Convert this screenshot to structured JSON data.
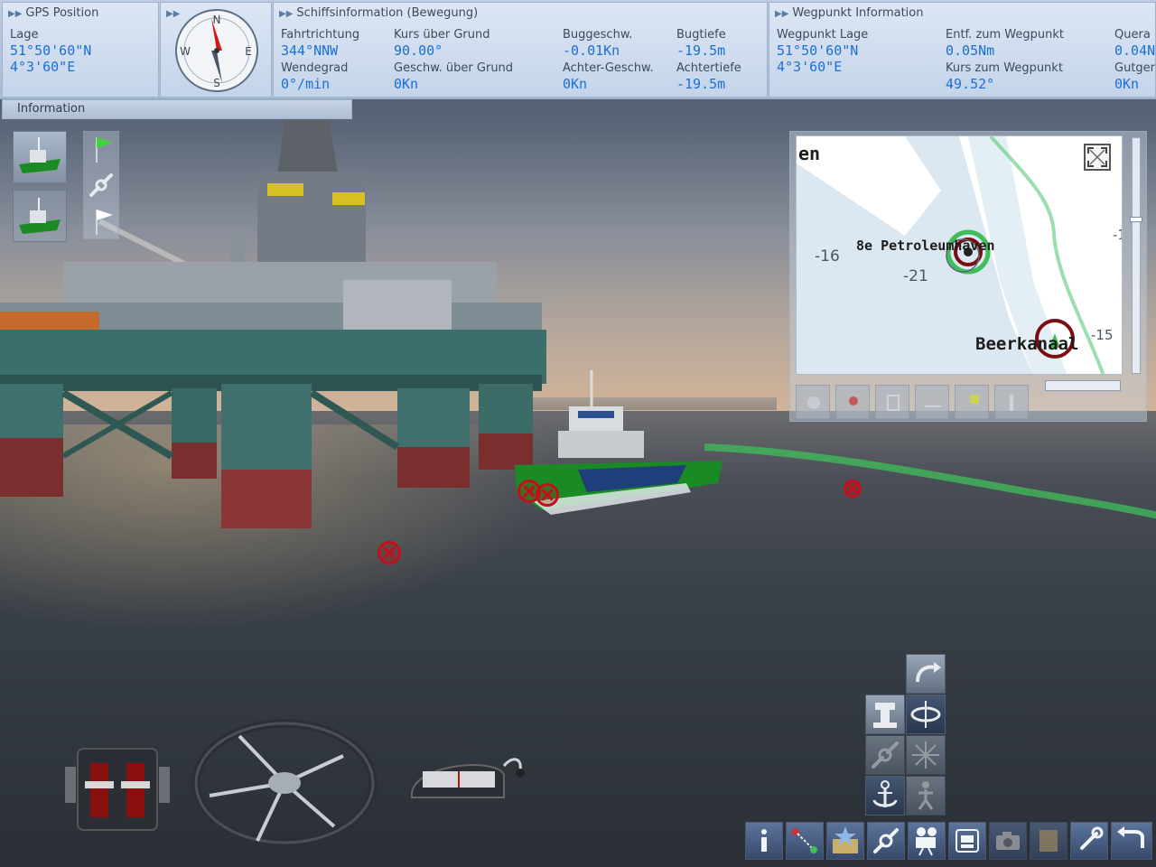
{
  "hud": {
    "gps": {
      "title": "GPS Position",
      "lage_label": "Lage",
      "lat": "51°50'60\"N",
      "lon": "4°3'60\"E"
    },
    "compass": {
      "n": "N",
      "e": "E",
      "s": "S",
      "w": "W"
    },
    "ship_info": {
      "title": "Schiffsinformation (Bewegung)",
      "fields": [
        {
          "label": "Fahrtrichtung",
          "value": "344°NNW"
        },
        {
          "label": "Kurs über Grund",
          "value": "90.00°"
        },
        {
          "label": "Buggeschw.",
          "value": "-0.01Kn"
        },
        {
          "label": "Bugtiefe",
          "value": "-19.5m"
        },
        {
          "label": "Wendegrad",
          "value": "0°/min"
        },
        {
          "label": "Geschw. über Grund",
          "value": "0Kn"
        },
        {
          "label": "Achter-Geschw.",
          "value": "0Kn"
        },
        {
          "label": "Achtertiefe",
          "value": "-19.5m"
        }
      ]
    },
    "waypoint": {
      "title": "Wegpunkt Information",
      "fields": [
        {
          "label": "Wegpunkt Lage",
          "value": "51°50'60\"N"
        },
        {
          "label": "",
          "value": "4°3'60\"E"
        },
        {
          "label": "Entf. zum Wegpunkt",
          "value": "0.05Nm"
        },
        {
          "label": "Kurs zum Wegpunkt",
          "value": "49.52°"
        },
        {
          "label": "Quera",
          "value": "0.04N"
        },
        {
          "label": "Gutger",
          "value": "0Kn"
        }
      ]
    },
    "info_tab": "Information"
  },
  "map": {
    "label_top": "en",
    "depth_1": "-16",
    "depth_2": "-21",
    "depth_3": "-15",
    "depth_4": "-1",
    "harbor_1": "8e Petroleumhaven",
    "harbor_2": "Beerkanaal"
  },
  "colors": {
    "hud_value": "#1b6fd6",
    "route": "#3fbf5a",
    "marker": "#c0101a"
  },
  "icons": {
    "left": [
      "ship-view-icon",
      "ship-view-2-icon",
      "green-flag-icon",
      "rope-link-icon",
      "white-flag-icon"
    ],
    "controls": [
      "turn-arrow-icon",
      "bollard-icon",
      "rotate-icon",
      "rope-icon",
      "compass-rose-icon",
      "anchor-icon",
      "person-icon"
    ],
    "toolbar": [
      "info-icon",
      "route-icon",
      "star-map-icon",
      "rope-icon",
      "camera-icon",
      "machine-telegraph-icon",
      "photo-camera-icon",
      "notepad-icon",
      "wrench-icon",
      "back-icon"
    ]
  }
}
